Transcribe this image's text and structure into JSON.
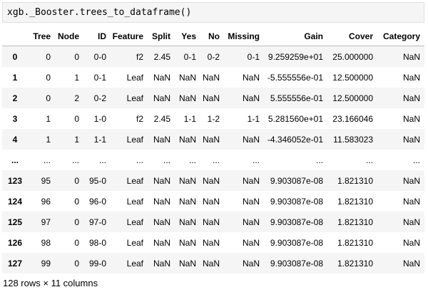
{
  "cell": {
    "code": "xgb._Booster.trees_to_dataframe()"
  },
  "table": {
    "columns": [
      "",
      "Tree",
      "Node",
      "ID",
      "Feature",
      "Split",
      "Yes",
      "No",
      "Missing",
      "Gain",
      "Cover",
      "Category"
    ],
    "rows": [
      [
        "0",
        "0",
        "0",
        "0-0",
        "f2",
        "2.45",
        "0-1",
        "0-2",
        "0-1",
        "9.259259e+01",
        "25.000000",
        "NaN"
      ],
      [
        "1",
        "0",
        "1",
        "0-1",
        "Leaf",
        "NaN",
        "NaN",
        "NaN",
        "NaN",
        "-5.555556e-01",
        "12.500000",
        "NaN"
      ],
      [
        "2",
        "0",
        "2",
        "0-2",
        "Leaf",
        "NaN",
        "NaN",
        "NaN",
        "NaN",
        "5.555556e-01",
        "12.500000",
        "NaN"
      ],
      [
        "3",
        "1",
        "0",
        "1-0",
        "f2",
        "2.45",
        "1-1",
        "1-2",
        "1-1",
        "5.281560e+01",
        "23.166046",
        "NaN"
      ],
      [
        "4",
        "1",
        "1",
        "1-1",
        "Leaf",
        "NaN",
        "NaN",
        "NaN",
        "NaN",
        "-4.346052e-01",
        "11.583023",
        "NaN"
      ],
      [
        "...",
        "...",
        "...",
        "...",
        "...",
        "...",
        "...",
        "...",
        "...",
        "...",
        "...",
        "..."
      ],
      [
        "123",
        "95",
        "0",
        "95-0",
        "Leaf",
        "NaN",
        "NaN",
        "NaN",
        "NaN",
        "9.903087e-08",
        "1.821310",
        "NaN"
      ],
      [
        "124",
        "96",
        "0",
        "96-0",
        "Leaf",
        "NaN",
        "NaN",
        "NaN",
        "NaN",
        "9.903087e-08",
        "1.821310",
        "NaN"
      ],
      [
        "125",
        "97",
        "0",
        "97-0",
        "Leaf",
        "NaN",
        "NaN",
        "NaN",
        "NaN",
        "9.903087e-08",
        "1.821310",
        "NaN"
      ],
      [
        "126",
        "98",
        "0",
        "98-0",
        "Leaf",
        "NaN",
        "NaN",
        "NaN",
        "NaN",
        "9.903087e-08",
        "1.821310",
        "NaN"
      ],
      [
        "127",
        "99",
        "0",
        "99-0",
        "Leaf",
        "NaN",
        "NaN",
        "NaN",
        "NaN",
        "9.903087e-08",
        "1.821310",
        "NaN"
      ]
    ]
  },
  "footer": {
    "summary": "128 rows × 11 columns"
  }
}
